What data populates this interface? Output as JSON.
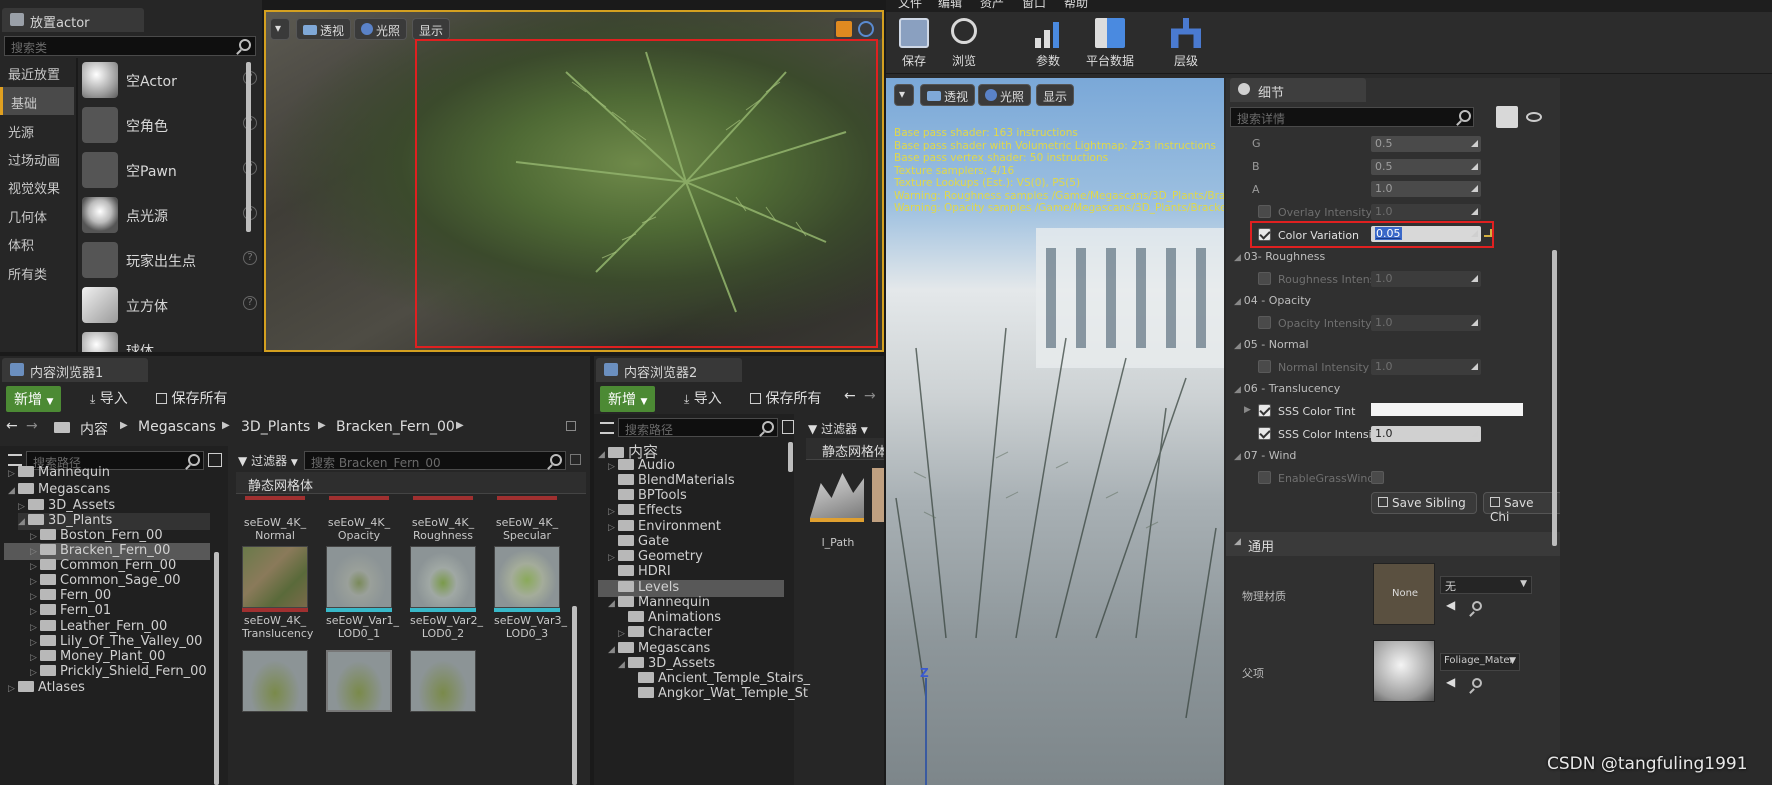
{
  "place_actor": {
    "tab_title": "放置actor",
    "search_placeholder": "搜索类",
    "categories": [
      "最近放置",
      "基础",
      "光源",
      "过场动画",
      "视觉效果",
      "几何体",
      "体积",
      "所有类"
    ],
    "items": [
      "空Actor",
      "空角色",
      "空Pawn",
      "点光源",
      "玩家出生点",
      "立方体",
      "球体"
    ]
  },
  "viewport_left": {
    "perspective": "透视",
    "lit": "光照",
    "show": "显示"
  },
  "material_editor": {
    "menu": [
      "文件",
      "编辑",
      "资产",
      "窗口",
      "帮助"
    ],
    "toolbar": [
      "保存",
      "浏览",
      "参数",
      "平台数据",
      "层级"
    ],
    "viewport": {
      "perspective": "透视",
      "lit": "光照",
      "show": "显示",
      "stats": [
        "Base pass shader: 163 instructions",
        "Base pass shader with Volumetric Lightmap: 253 instructions",
        "Base pass vertex shader: 50 instructions",
        "Texture samplers: 4/16",
        "Texture Lookups (Est.): VS(0), PS(5)",
        "Warning: Roughness samples /Game/Megascans/3D_Plants/Bracken_F",
        "Warning: Opacity samples /Game/Megascans/3D_Plants/Bracken_Fer"
      ],
      "axis_z": "Z"
    }
  },
  "details": {
    "tab_title": "细节",
    "search_placeholder": "搜索详情",
    "rows": [
      {
        "label": "G",
        "value": "0.5"
      },
      {
        "label": "B",
        "value": "0.5"
      },
      {
        "label": "A",
        "value": "1.0"
      }
    ],
    "overlay_intensity": {
      "label": "Overlay Intensity",
      "value": "1.0"
    },
    "color_variation": {
      "label": "Color Variation",
      "value": "0.05"
    },
    "sections": {
      "roughness": "03- Roughness",
      "opacity": "04 - Opacity",
      "normal": "05 - Normal",
      "translucency": "06 - Translucency",
      "wind": "07 - Wind"
    },
    "roughness_intensity": {
      "label": "Roughness Intensity",
      "value": "1.0"
    },
    "opacity_intensity": {
      "label": "Opacity Intensity",
      "value": "1.0"
    },
    "normal_intensity": {
      "label": "Normal Intensity",
      "value": "1.0"
    },
    "sss_color_tint": {
      "label": "SSS Color Tint"
    },
    "sss_color_intensity": {
      "label": "SSS Color Intensity",
      "value": "1.0"
    },
    "enable_grass_wind": {
      "label": "EnableGrassWind"
    },
    "save_sibling": "Save Sibling",
    "save_child": "Save Chi",
    "general": "通用",
    "phys_material": "物理材质",
    "phys_none": "None",
    "phys_select": "无",
    "parent": "父项",
    "parent_select": "Foliage_Mater"
  },
  "content_browser_1": {
    "tab_title": "内容浏览器1",
    "add_new": "新增",
    "import": "导入",
    "save_all": "保存所有",
    "breadcrumb": [
      "内容",
      "Megascans",
      "3D_Plants",
      "Bracken_Fern_00"
    ],
    "path_search_placeholder": "搜索路径",
    "filters": "过滤器",
    "asset_search_placeholder": "搜索 Bracken_Fern_00",
    "category": "静态网格体",
    "tree": [
      {
        "label": "Mannequin",
        "depth": 1
      },
      {
        "label": "Megascans",
        "depth": 1
      },
      {
        "label": "3D_Assets",
        "depth": 2
      },
      {
        "label": "3D_Plants",
        "depth": 2
      },
      {
        "label": "Boston_Fern_00",
        "depth": 3
      },
      {
        "label": "Bracken_Fern_00",
        "depth": 3
      },
      {
        "label": "Common_Fern_00",
        "depth": 3
      },
      {
        "label": "Common_Sage_00",
        "depth": 3
      },
      {
        "label": "Fern_00",
        "depth": 3
      },
      {
        "label": "Fern_01",
        "depth": 3
      },
      {
        "label": "Leather_Fern_00",
        "depth": 3
      },
      {
        "label": "Lily_Of_The_Valley_00",
        "depth": 3
      },
      {
        "label": "Money_Plant_00",
        "depth": 3
      },
      {
        "label": "Prickly_Shield_Fern_00",
        "depth": 3
      },
      {
        "label": "Atlases",
        "depth": 1
      }
    ],
    "assets_row1": [
      {
        "name": "seEoW_4K_\nNormal"
      },
      {
        "name": "seEoW_4K_\nOpacity"
      },
      {
        "name": "seEoW_4K_\nRoughness"
      },
      {
        "name": "seEoW_4K_\nSpecular"
      }
    ],
    "assets_row2": [
      {
        "name": "seEoW_4K_\nTranslucency"
      },
      {
        "name": "seEoW_Var1_\nLOD0_1"
      },
      {
        "name": "seEoW_Var2_\nLOD0_2"
      },
      {
        "name": "seEoW_Var3_\nLOD0_3"
      }
    ]
  },
  "content_browser_2": {
    "tab_title": "内容浏览器2",
    "add_new": "新增",
    "import": "导入",
    "save_all": "保存所有",
    "path_search_placeholder": "搜索路径",
    "filters": "过滤器",
    "category": "静态网格体",
    "asset_name": "l_Path",
    "tree": [
      {
        "label": "内容",
        "depth": 0
      },
      {
        "label": "Audio",
        "depth": 1
      },
      {
        "label": "BlendMaterials",
        "depth": 1
      },
      {
        "label": "BPTools",
        "depth": 1
      },
      {
        "label": "Effects",
        "depth": 1
      },
      {
        "label": "Environment",
        "depth": 1
      },
      {
        "label": "Gate",
        "depth": 1
      },
      {
        "label": "Geometry",
        "depth": 1
      },
      {
        "label": "HDRI",
        "depth": 1
      },
      {
        "label": "Levels",
        "depth": 1
      },
      {
        "label": "Mannequin",
        "depth": 1
      },
      {
        "label": "Animations",
        "depth": 2
      },
      {
        "label": "Character",
        "depth": 2
      },
      {
        "label": "Megascans",
        "depth": 1
      },
      {
        "label": "3D_Assets",
        "depth": 2
      },
      {
        "label": "Ancient_Temple_Stairs_",
        "depth": 3
      },
      {
        "label": "Angkor_Wat_Temple_St",
        "depth": 3
      }
    ]
  },
  "watermark": "CSDN @tangfuling1991"
}
